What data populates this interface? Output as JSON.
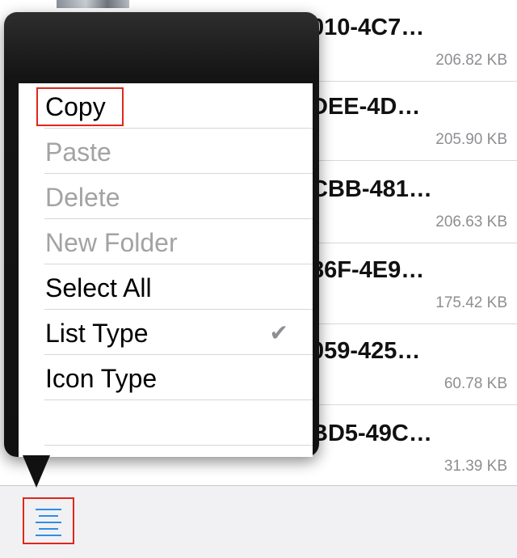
{
  "files": [
    {
      "name": "010-4C7…",
      "size": "206.82 KB"
    },
    {
      "name": "DEE-4D…",
      "size": "205.90 KB"
    },
    {
      "name": "CBB-481…",
      "size": "206.63 KB"
    },
    {
      "name": "86F-4E9…",
      "size": "175.42 KB"
    },
    {
      "name": "059-425…",
      "size": "60.78 KB"
    },
    {
      "name": "BD5-49C…",
      "size": "31.39 KB"
    }
  ],
  "menu": {
    "items": [
      {
        "label": "Copy",
        "enabled": true
      },
      {
        "label": "Paste",
        "enabled": false
      },
      {
        "label": "Delete",
        "enabled": false
      },
      {
        "label": "New Folder",
        "enabled": false
      },
      {
        "label": "Select All",
        "enabled": true
      },
      {
        "label": "List Type",
        "enabled": true,
        "checked": true
      },
      {
        "label": "Icon Type",
        "enabled": true
      }
    ],
    "check_glyph": "✔"
  },
  "toolbar": {
    "menu_icon": "list-menu-icon"
  },
  "colors": {
    "accent": "#2d8fe5",
    "highlight": "#e0261b",
    "disabled_text": "#a3a3a3"
  }
}
